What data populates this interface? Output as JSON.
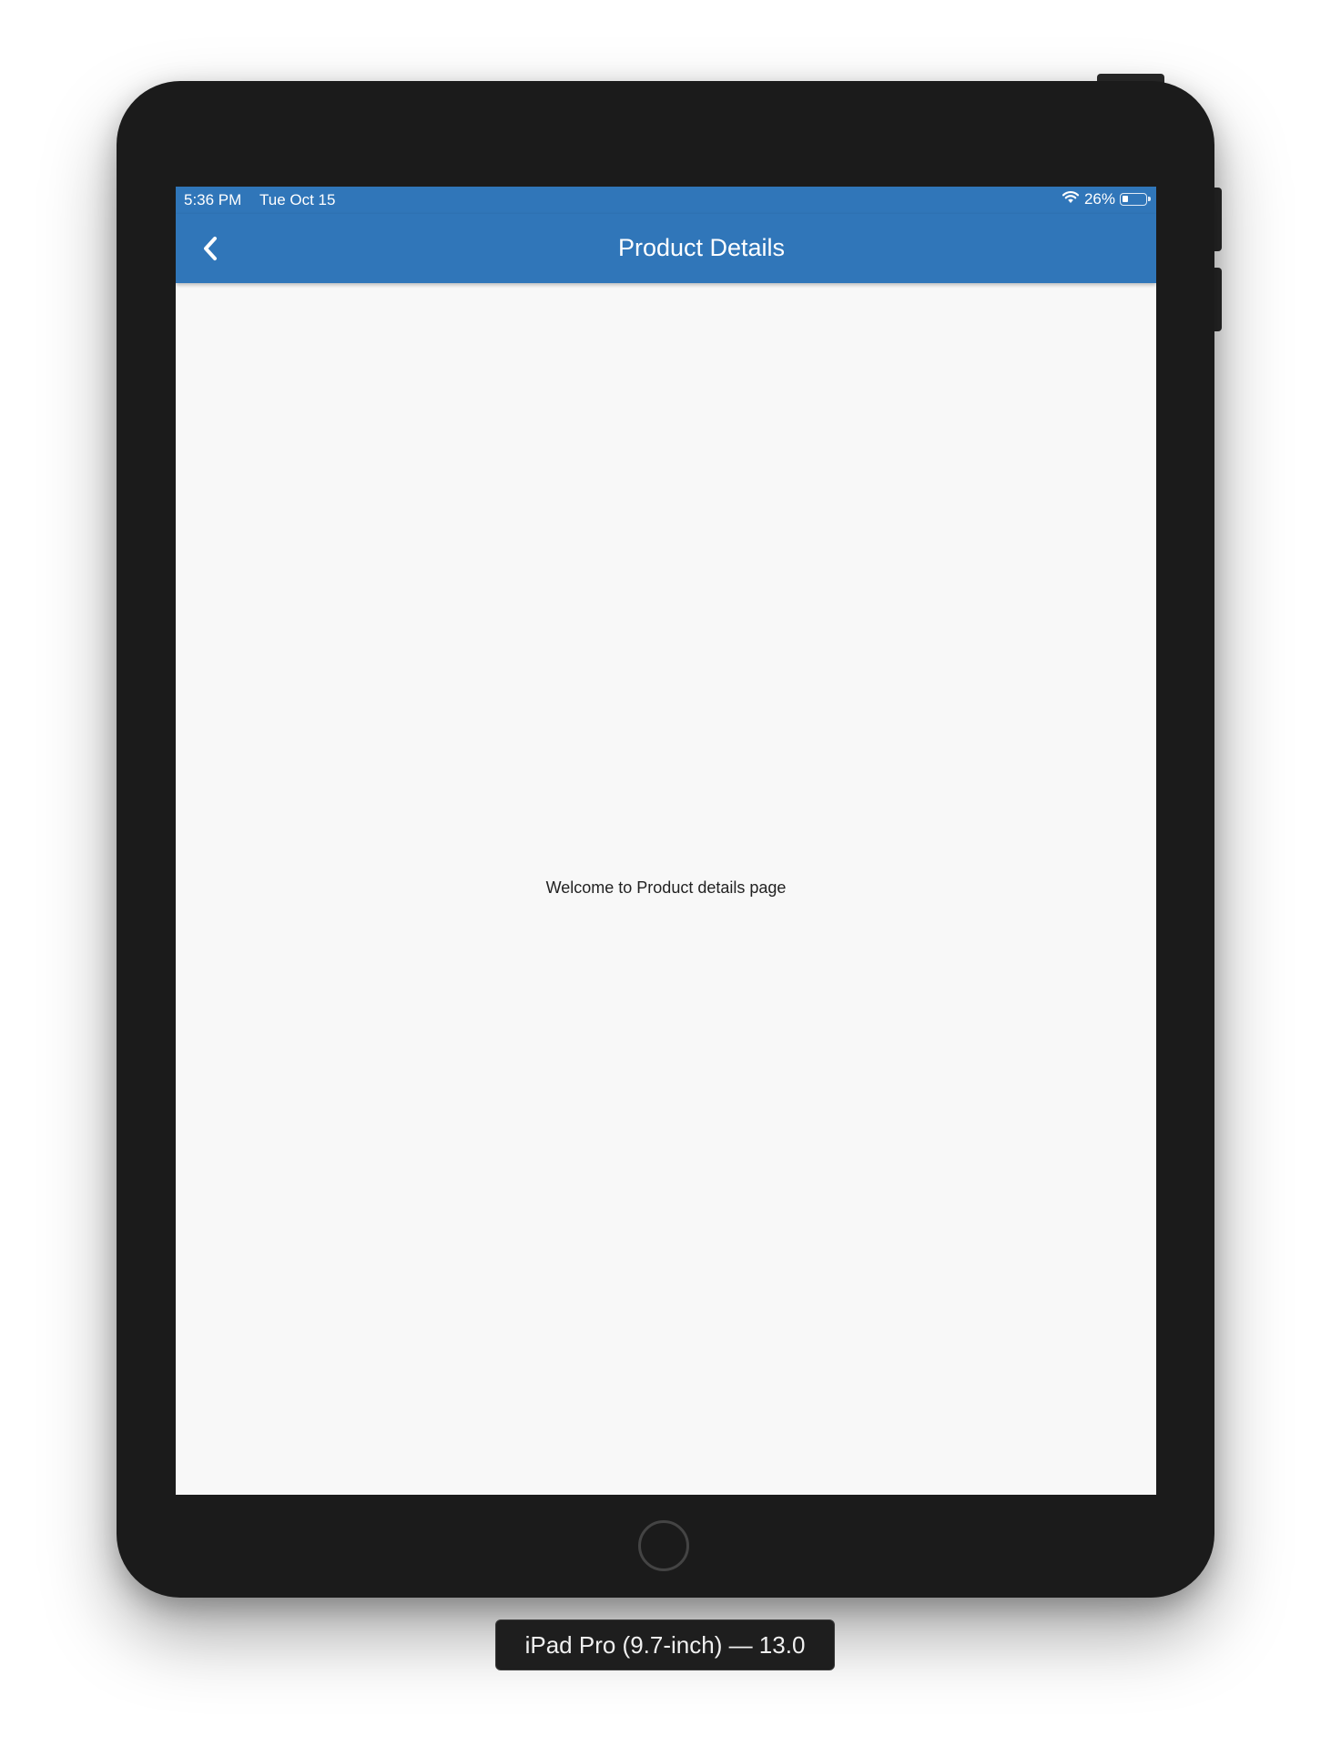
{
  "status_bar": {
    "time": "5:36 PM",
    "date": "Tue Oct 15",
    "battery_percent": "26%",
    "battery_level": 0.26
  },
  "nav_bar": {
    "title": "Product Details",
    "back_icon": "chevron-left-icon"
  },
  "content": {
    "message": "Welcome to Product details page"
  },
  "device_label": "iPad Pro (9.7-inch) — 13.0",
  "colors": {
    "nav_background": "#3076b9",
    "screen_background": "#f8f8f8",
    "device_bezel": "#1b1b1b"
  }
}
